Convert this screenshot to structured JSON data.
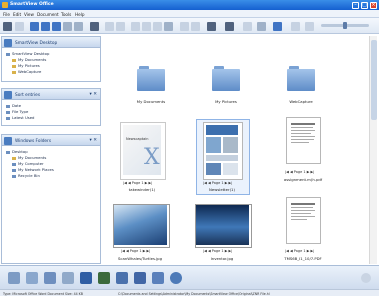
{
  "window": {
    "title": "SmartView Office"
  },
  "menu": [
    "File",
    "Edit",
    "View",
    "Document",
    "Tools",
    "Help"
  ],
  "panels": {
    "desktop": {
      "title": "SmartView Desktop",
      "items": [
        "SmartView Desktop",
        "My Documents",
        "My Pictures",
        "WebCapture"
      ]
    },
    "sort": {
      "title": "Sort entries",
      "items": [
        "Date",
        "File Type",
        "Latest Used"
      ]
    },
    "folders": {
      "title": "Windows Folders",
      "items": [
        "Desktop",
        "My Documents",
        "My Computer",
        "My Network Places",
        "Recycle Bin"
      ]
    }
  },
  "folders": [
    {
      "name": "My Documents"
    },
    {
      "name": "My Pictures"
    },
    {
      "name": "WebCapture"
    }
  ],
  "files_row1": [
    {
      "name": "takewinder(1)",
      "page": "Page 1"
    },
    {
      "name": "Newsletter(1)",
      "page": "Page 1"
    },
    {
      "name": "assignment.m(h.pdf",
      "page": "Page 1"
    }
  ],
  "files_row2": [
    {
      "name": "ScanWhales/Turtles.jpg",
      "page": "Page 1"
    },
    {
      "name": "Inventor.jpg",
      "page": "Page 1"
    },
    {
      "name": "TMS6B_I1_10/7.PDF",
      "page": "Page 1"
    }
  ],
  "thumb_text": {
    "nav": "|◀ ◀  Page 1  ▶ ▶|",
    "newscaptain": "Newscaptain"
  },
  "status": {
    "left": "Type: Microsoft Office Word Document   Size: 44 KB",
    "right": "C:\\Documents and Settings\\Administrator\\My Documents\\SmartView Office\\Original\\ZNR File.hl"
  },
  "colors": {
    "titlebar": "#1560d0",
    "panel": "#c7d7ed",
    "selection": "#8fb4e6"
  }
}
